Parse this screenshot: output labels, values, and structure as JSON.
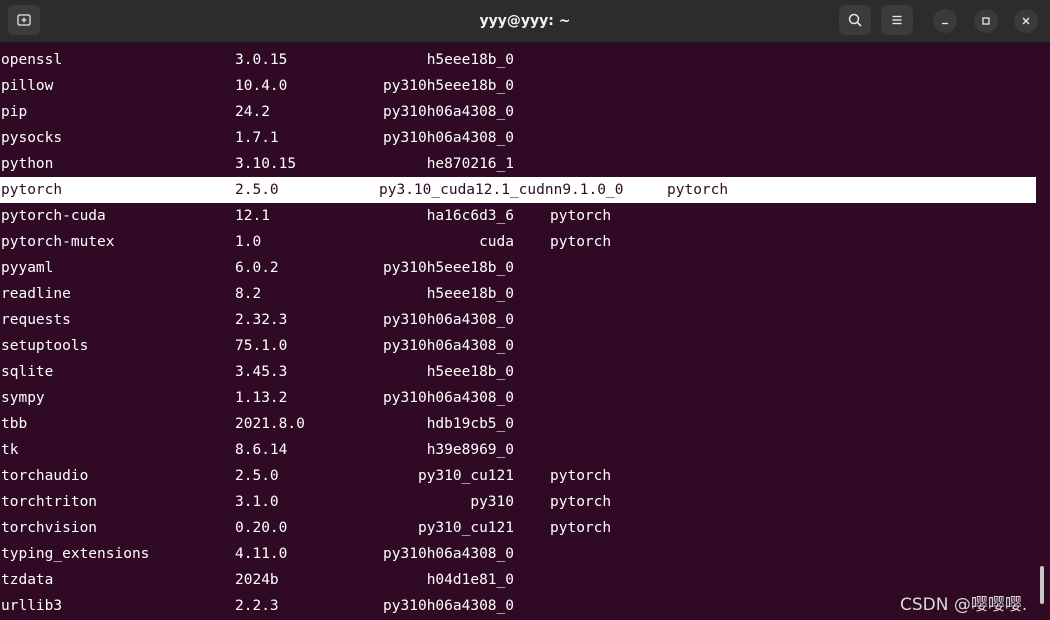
{
  "window": {
    "title": "yyy@yyy: ~",
    "icons": {
      "new_tab": "new-tab-icon",
      "search": "search-icon",
      "menu": "hamburger-menu-icon",
      "minimize": "minimize-icon",
      "maximize": "maximize-icon",
      "close": "close-icon"
    }
  },
  "colors": {
    "terminal_bg": "#300a24",
    "titlebar_bg": "#2c2c2c",
    "text": "#ffffff",
    "selection_bg": "#ffffff"
  },
  "packages": [
    {
      "name": "openssl",
      "version": "3.0.15",
      "build": "h5eee18b_0",
      "channel": ""
    },
    {
      "name": "pillow",
      "version": "10.4.0",
      "build": "py310h5eee18b_0",
      "channel": ""
    },
    {
      "name": "pip",
      "version": "24.2",
      "build": "py310h06a4308_0",
      "channel": ""
    },
    {
      "name": "pysocks",
      "version": "1.7.1",
      "build": "py310h06a4308_0",
      "channel": ""
    },
    {
      "name": "python",
      "version": "3.10.15",
      "build": "he870216_1",
      "channel": ""
    },
    {
      "name": "pytorch",
      "version": "2.5.0",
      "build": "py3.10_cuda12.1_cudnn9.1.0_0",
      "channel": "pytorch",
      "selected": true
    },
    {
      "name": "pytorch-cuda",
      "version": "12.1",
      "build": "ha16c6d3_6",
      "channel": "pytorch"
    },
    {
      "name": "pytorch-mutex",
      "version": "1.0",
      "build": "cuda",
      "channel": "pytorch"
    },
    {
      "name": "pyyaml",
      "version": "6.0.2",
      "build": "py310h5eee18b_0",
      "channel": ""
    },
    {
      "name": "readline",
      "version": "8.2",
      "build": "h5eee18b_0",
      "channel": ""
    },
    {
      "name": "requests",
      "version": "2.32.3",
      "build": "py310h06a4308_0",
      "channel": ""
    },
    {
      "name": "setuptools",
      "version": "75.1.0",
      "build": "py310h06a4308_0",
      "channel": ""
    },
    {
      "name": "sqlite",
      "version": "3.45.3",
      "build": "h5eee18b_0",
      "channel": ""
    },
    {
      "name": "sympy",
      "version": "1.13.2",
      "build": "py310h06a4308_0",
      "channel": ""
    },
    {
      "name": "tbb",
      "version": "2021.8.0",
      "build": "hdb19cb5_0",
      "channel": ""
    },
    {
      "name": "tk",
      "version": "8.6.14",
      "build": "h39e8969_0",
      "channel": ""
    },
    {
      "name": "torchaudio",
      "version": "2.5.0",
      "build": "py310_cu121",
      "channel": "pytorch"
    },
    {
      "name": "torchtriton",
      "version": "3.1.0",
      "build": "py310",
      "channel": "pytorch"
    },
    {
      "name": "torchvision",
      "version": "0.20.0",
      "build": "py310_cu121",
      "channel": "pytorch"
    },
    {
      "name": "typing_extensions",
      "version": "4.11.0",
      "build": "py310h06a4308_0",
      "channel": ""
    },
    {
      "name": "tzdata",
      "version": "2024b",
      "build": "h04d1e81_0",
      "channel": ""
    },
    {
      "name": "urllib3",
      "version": "2.2.3",
      "build": "py310h06a4308_0",
      "channel": ""
    }
  ],
  "watermark": "CSDN @嘤嘤嘤."
}
